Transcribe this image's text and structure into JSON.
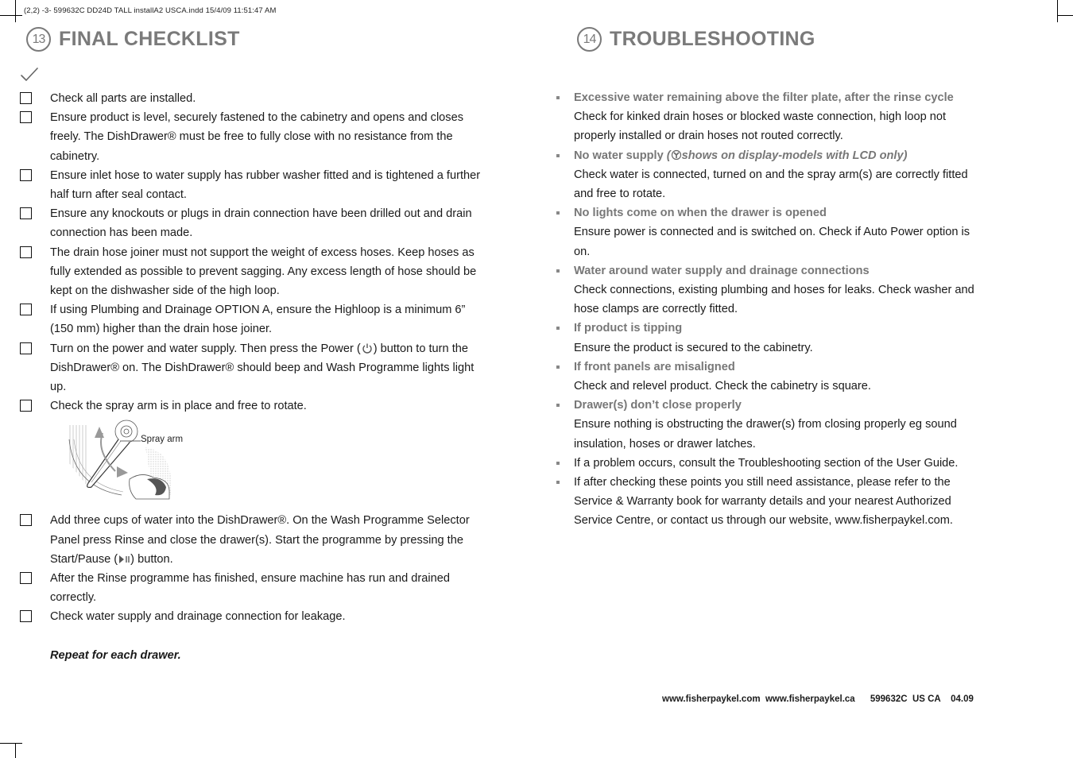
{
  "slug_line": "(2,2)  -3- 599632C DD24D TALL installA2 USCA.indd 15/4/09 11:51:47 AM",
  "left_section": {
    "number": "13",
    "title": "FINAL CHECKLIST",
    "checkmark_icon": "checkmark-icon",
    "items": [
      {
        "text": "Check all parts are installed."
      },
      {
        "text": "Ensure product is level, securely fastened to the cabinetry and opens and closes freely. The DishDrawer® must be free to fully close with no resistance from the cabinetry."
      },
      {
        "text": "Ensure inlet hose to water supply has rubber washer fitted and is tightened a further half turn after seal contact."
      },
      {
        "text": "Ensure any knockouts or plugs in drain connection have been drilled out and drain connection has been made."
      },
      {
        "text": "The drain hose joiner must not support the weight of excess hoses. Keep hoses as fully extended as possible to prevent sagging. Any excess length of hose should be kept on the dishwasher side of the high loop."
      },
      {
        "text": "If using Plumbing and Drainage OPTION A, ensure the Highloop is a minimum 6” (150 mm) higher than the drain hose joiner."
      },
      {
        "text_before": "Turn on the power and water supply. Then press the Power (",
        "icon": "power-icon",
        "text_after": ") button to turn the DishDrawer® on. The DishDrawer® should beep and Wash Programme lights light up."
      },
      {
        "text": "Check the spray arm is in place and free to rotate."
      },
      {
        "text_before": "Add three cups of water into the DishDrawer®. On the Wash Programme Selector Panel press Rinse and close the drawer(s). Start the programme by pressing the Start/Pause (",
        "icon": "play-pause-icon",
        "text_after": ") button."
      },
      {
        "text": "After the Rinse programme has finished, ensure machine has run and drained correctly."
      },
      {
        "text": "Check water supply and drainage connection for leakage."
      }
    ],
    "figure_label": "Spray arm",
    "repeat_note": "Repeat for each drawer."
  },
  "right_section": {
    "number": "14",
    "title": "TROUBLESHOOTING",
    "items": [
      {
        "title": "Excessive water remaining above the filter plate, after the rinse cycle",
        "body": "Check for kinked drain hoses or blocked waste connection, high loop not properly installed or drain hoses not routed correctly."
      },
      {
        "title": "No water supply",
        "note_before": "(",
        "note_icon": "no-water-icon",
        "note_after": "shows on display-models with LCD only)",
        "body": "Check water is connected, turned on and the spray arm(s) are correctly fitted and free to rotate."
      },
      {
        "title": "No lights come on when the drawer is opened",
        "body": "Ensure power is connected and is switched on. Check if Auto Power option is on."
      },
      {
        "title": "Water around water supply and drainage connections",
        "body": "Check connections, existing plumbing and hoses for leaks. Check washer and hose clamps are correctly fitted."
      },
      {
        "title": "If product is tipping",
        "body": "Ensure the product is secured to the cabinetry."
      },
      {
        "title": "If front panels are misaligned",
        "body": "Check and relevel product. Check the cabinetry is square."
      },
      {
        "title": "Drawer(s) don’t close properly",
        "body": "Ensure nothing is obstructing the drawer(s) from closing properly eg sound insulation, hoses or drawer latches."
      },
      {
        "body": "If a problem occurs, consult the Troubleshooting section of the User Guide."
      },
      {
        "body": "If after checking these points you still need assistance, please refer to the Service & Warranty book for warranty details and your nearest Authorized Service Centre, or contact us through our website, www.fisherpaykel.com."
      }
    ]
  },
  "footer": {
    "url_com": "www.fisherpaykel.com",
    "url_ca": "www.fisherpaykel.ca",
    "code": "599632C",
    "region": "US CA",
    "date": "04.09"
  }
}
